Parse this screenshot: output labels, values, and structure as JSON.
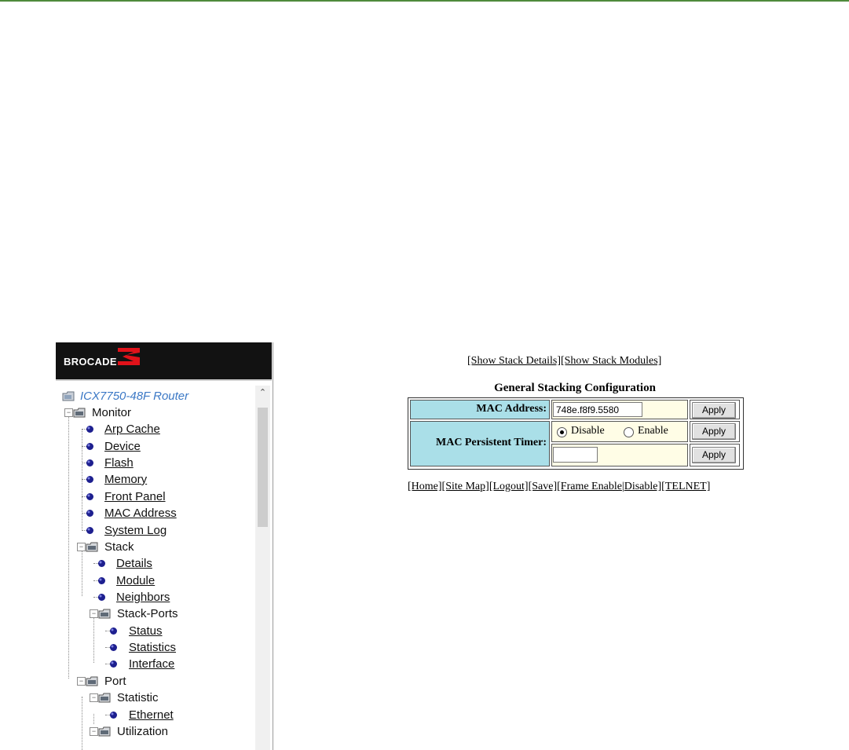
{
  "brand": {
    "name": "BROCADE"
  },
  "nav": {
    "root": "ICX7750-48F Router",
    "monitor": "Monitor",
    "monitor_items": [
      "Arp Cache",
      "Device",
      "Flash",
      "Memory",
      "Front Panel",
      "MAC Address",
      "System Log"
    ],
    "stack": "Stack",
    "stack_items": [
      "Details",
      "Module",
      "Neighbors"
    ],
    "stack_ports": "Stack-Ports",
    "stack_ports_items": [
      "Status",
      "Statistics",
      "Interface"
    ],
    "port": "Port",
    "statistic": "Statistic",
    "statistic_items": [
      "Ethernet"
    ],
    "utilization": "Utilization"
  },
  "main": {
    "top_links": [
      "[Show Stack Details]",
      "[Show Stack Modules]"
    ],
    "title": "General Stacking Configuration",
    "mac_address_label": "MAC Address:",
    "mac_address_value": "748e.f8f9.5580",
    "mac_timer_label": "MAC Persistent Timer:",
    "radio_disable": "Disable",
    "radio_enable": "Enable",
    "selected_radio": "Disable",
    "timer_value": "",
    "apply_label": "Apply",
    "bottom_links": [
      "[Home]",
      "[Site Map]",
      "[Logout]",
      "[Save]",
      "[Frame Enable",
      "|",
      "Disable]",
      "[TELNET]"
    ]
  },
  "colors": {
    "header_cell": "#aadfe8",
    "value_cell": "#fffde6",
    "top_rule": "#4f8a3c",
    "root_link": "#3b78c5"
  }
}
